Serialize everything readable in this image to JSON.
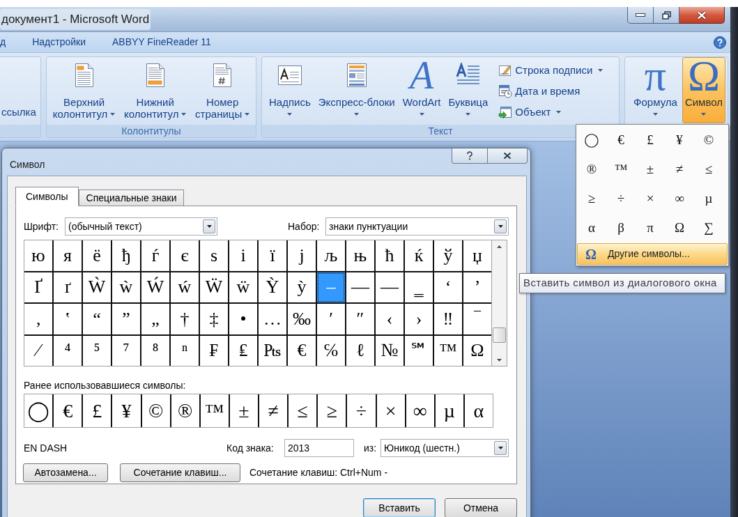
{
  "window": {
    "title": "документ1 - Microsoft Word"
  },
  "ribbon_tabs": [
    {
      "label": "д",
      "selected": false
    },
    {
      "label": "Надстройки",
      "selected": false
    },
    {
      "label": "ABBYY FineReader 11",
      "selected": false
    }
  ],
  "ribbon_groups": [
    {
      "small_buttons": [
        {
          "kind": "plain",
          "label": "ссылка",
          "dropdown": false
        }
      ]
    },
    {
      "label": "Колонтитулы",
      "buttons": [
        {
          "kind": "header",
          "label": "Верхний колонтитул",
          "dropdown": true,
          "pressed": false
        },
        {
          "kind": "footer",
          "label": "Нижний колонтитул",
          "dropdown": true,
          "pressed": false
        },
        {
          "kind": "pagenumber",
          "label": "Номер страницы",
          "dropdown": true,
          "pressed": false
        }
      ]
    },
    {
      "label": "Текст",
      "buttons": [
        {
          "kind": "textbox",
          "label": "Надпись",
          "dropdown": true,
          "pressed": false
        },
        {
          "kind": "quickparts",
          "label": "Экспресс-блоки",
          "dropdown": true,
          "pressed": false
        },
        {
          "kind": "wordart",
          "glyph": "A",
          "label": "WordArt",
          "dropdown": true,
          "pressed": false
        },
        {
          "kind": "dropcap",
          "label": "Буквица",
          "dropdown": true,
          "pressed": false
        }
      ],
      "small_buttons": [
        {
          "kind": "signature",
          "label": "Строка подписи",
          "dropdown": true
        },
        {
          "kind": "datetime",
          "label": "Дата и время",
          "dropdown": false
        },
        {
          "kind": "object",
          "label": "Объект",
          "dropdown": true
        }
      ]
    },
    {
      "buttons": [
        {
          "kind": "equation",
          "glyph": "π",
          "label": "Формула",
          "dropdown": true,
          "pressed": false
        },
        {
          "kind": "symbol",
          "glyph": "Ω",
          "label": "Символ",
          "dropdown": true,
          "pressed": true
        }
      ]
    }
  ],
  "symbol_menu": {
    "symbols": [
      "◯",
      "€",
      "£",
      "¥",
      "©",
      "®",
      "™",
      "±",
      "≠",
      "≤",
      "≥",
      "÷",
      "×",
      "∞",
      "µ",
      "α",
      "β",
      "π",
      "Ω",
      "∑"
    ],
    "more_item": {
      "glyph": "Ω",
      "label": "Другие символы...",
      "highlighted": true
    }
  },
  "tooltip": "Вставить символ из диалогового окна",
  "dialog": {
    "title": "Символ",
    "tabs": [
      {
        "label": "Символы",
        "selected": true
      },
      {
        "label": "Специальные знаки",
        "selected": false
      }
    ],
    "font": {
      "label": "Шрифт:",
      "value": "(обычный текст)"
    },
    "subset": {
      "label": "Набор:",
      "value": "знаки пунктуации"
    },
    "symbol_grid": [
      {
        "symbol": "ю",
        "selected": false
      },
      {
        "symbol": "я",
        "selected": false
      },
      {
        "symbol": "ё",
        "selected": false
      },
      {
        "symbol": "ђ",
        "selected": false
      },
      {
        "symbol": "ѓ",
        "selected": false
      },
      {
        "symbol": "є",
        "selected": false
      },
      {
        "symbol": "ѕ",
        "selected": false
      },
      {
        "symbol": "і",
        "selected": false
      },
      {
        "symbol": "ї",
        "selected": false
      },
      {
        "symbol": "ј",
        "selected": false
      },
      {
        "symbol": "љ",
        "selected": false
      },
      {
        "symbol": "њ",
        "selected": false
      },
      {
        "symbol": "ћ",
        "selected": false
      },
      {
        "symbol": "ќ",
        "selected": false
      },
      {
        "symbol": "ў",
        "selected": false
      },
      {
        "symbol": "џ",
        "selected": false
      },
      {
        "symbol": "Ґ",
        "selected": false
      },
      {
        "symbol": "ґ",
        "selected": false
      },
      {
        "symbol": "Ẁ",
        "selected": false
      },
      {
        "symbol": "ẁ",
        "selected": false
      },
      {
        "symbol": "Ẃ",
        "selected": false
      },
      {
        "symbol": "ẃ",
        "selected": false
      },
      {
        "symbol": "Ẅ",
        "selected": false
      },
      {
        "symbol": "ẅ",
        "selected": false
      },
      {
        "symbol": "Ỳ",
        "selected": false
      },
      {
        "symbol": "ỳ",
        "selected": false
      },
      {
        "symbol": "–",
        "selected": true
      },
      {
        "symbol": "—",
        "selected": false
      },
      {
        "symbol": "―",
        "selected": false
      },
      {
        "symbol": "‗",
        "selected": false
      },
      {
        "symbol": "‘",
        "selected": false
      },
      {
        "symbol": "’",
        "selected": false
      },
      {
        "symbol": "‚",
        "selected": false
      },
      {
        "symbol": "‛",
        "selected": false
      },
      {
        "symbol": "“",
        "selected": false
      },
      {
        "symbol": "”",
        "selected": false
      },
      {
        "symbol": "„",
        "selected": false
      },
      {
        "symbol": "†",
        "selected": false
      },
      {
        "symbol": "‡",
        "selected": false
      },
      {
        "symbol": "•",
        "selected": false
      },
      {
        "symbol": "…",
        "selected": false
      },
      {
        "symbol": "‰",
        "selected": false
      },
      {
        "symbol": "′",
        "selected": false
      },
      {
        "symbol": "″",
        "selected": false
      },
      {
        "symbol": "‹",
        "selected": false
      },
      {
        "symbol": "›",
        "selected": false
      },
      {
        "symbol": "‼",
        "selected": false
      },
      {
        "symbol": "‾",
        "selected": false
      },
      {
        "symbol": "⁄",
        "selected": false
      },
      {
        "symbol": "⁴",
        "selected": false
      },
      {
        "symbol": "⁵",
        "selected": false
      },
      {
        "symbol": "⁷",
        "selected": false
      },
      {
        "symbol": "⁸",
        "selected": false
      },
      {
        "symbol": "ⁿ",
        "selected": false
      },
      {
        "symbol": "₣",
        "selected": false
      },
      {
        "symbol": "₤",
        "selected": false
      },
      {
        "symbol": "₧",
        "selected": false
      },
      {
        "symbol": "€",
        "selected": false
      },
      {
        "symbol": "℅",
        "selected": false
      },
      {
        "symbol": "ℓ",
        "selected": false
      },
      {
        "symbol": "№",
        "selected": false
      },
      {
        "symbol": "℠",
        "selected": false
      },
      {
        "symbol": "™",
        "selected": false
      },
      {
        "symbol": "Ω",
        "selected": false
      }
    ],
    "recent_label": "Ранее использовавшиеся символы:",
    "recent_symbols": [
      "◯",
      "€",
      "£",
      "¥",
      "©",
      "®",
      "™",
      "±",
      "≠",
      "≤",
      "≥",
      "÷",
      "×",
      "∞",
      "µ",
      "α"
    ],
    "character_name": "EN DASH",
    "char_code": {
      "label": "Код знака:",
      "value": "2013"
    },
    "encoding": {
      "label": "из:",
      "value": "Юникод (шестн.)"
    },
    "buttons": [
      {
        "label": "Автозамена..."
      },
      {
        "label": "Сочетание клавиш..."
      }
    ],
    "shortcut_text": "Сочетание клавиш: Ctrl+Num -",
    "footer_buttons": [
      {
        "label": "Вставить",
        "default": true
      },
      {
        "label": "Отмена",
        "default": false
      }
    ]
  }
}
